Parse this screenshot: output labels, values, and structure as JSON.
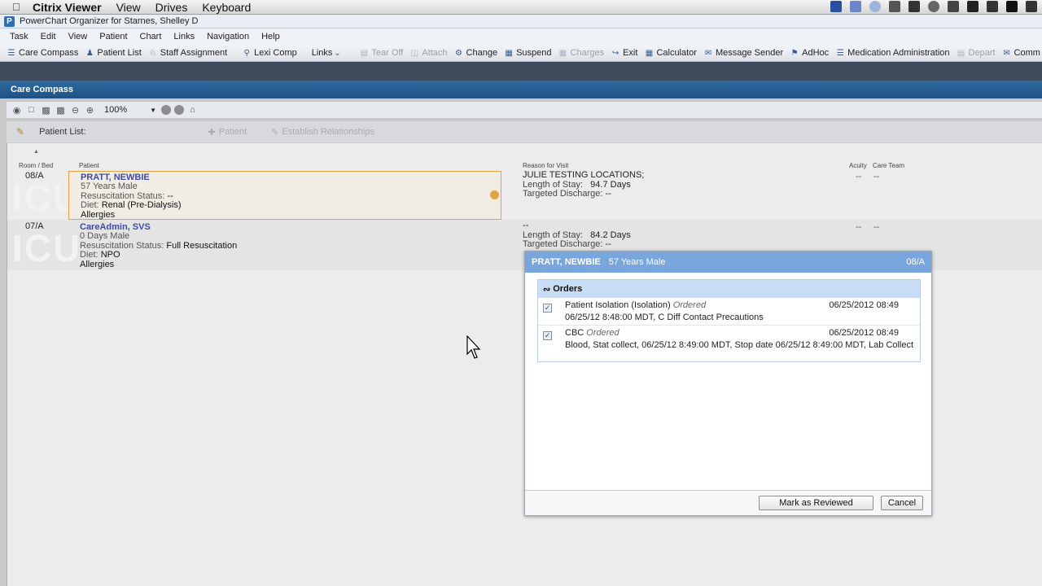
{
  "mac_menu": {
    "items": [
      "Citrix Viewer",
      "View",
      "Drives",
      "Keyboard"
    ]
  },
  "app": {
    "badge": "P",
    "title": "PowerChart Organizer for Starnes, Shelley D"
  },
  "menu": [
    "Task",
    "Edit",
    "View",
    "Patient",
    "Chart",
    "Links",
    "Navigation",
    "Help"
  ],
  "toolbar": {
    "care_compass": "Care Compass",
    "patient_list": "Patient List",
    "staff_assignment": "Staff Assignment",
    "lexi_comp": "Lexi Comp",
    "links": "Links",
    "tear_off": "Tear Off",
    "attach": "Attach",
    "change": "Change",
    "suspend": "Suspend",
    "charges": "Charges",
    "exit": "Exit",
    "calculator": "Calculator",
    "message_sender": "Message Sender",
    "adhoc": "AdHoc",
    "med_admin": "Medication Administration",
    "depart": "Depart",
    "comm": "Comm"
  },
  "care_compass": {
    "title": "Care Compass",
    "zoom": "100%",
    "patient_list_label": "Patient List:",
    "add_patient": "Patient",
    "establish_relationships": "Establish Relationships",
    "columns": {
      "room_bed": "Room / Bed",
      "patient": "Patient",
      "reason": "Reason for Visit",
      "acuity": "Acuity",
      "care_team": "Care Team"
    },
    "watermark": "ICU",
    "patients": [
      {
        "bed": "08/A",
        "name": "PRATT, NEWBIE",
        "age_sex": "57 Years  Male",
        "resus_label": "Resuscitation Status:",
        "resus_value": "--",
        "diet_label": "Diet:",
        "diet_value": "Renal (Pre-Dialysis)",
        "allergies": "Allergies",
        "reason": "JULIE TESTING LOCATIONS;",
        "los_label": "Length of Stay:",
        "los_value": "94.7 Days",
        "discharge_label": "Targeted Discharge:",
        "discharge_value": "--",
        "acuity": "--",
        "care_team": "--"
      },
      {
        "bed": "07/A",
        "name": "CareAdmin, SVS",
        "age_sex": "0 Days  Male",
        "resus_label": "Resuscitation Status:",
        "resus_value": "Full Resuscitation",
        "diet_label": "Diet:",
        "diet_value": "NPO",
        "allergies": "Allergies",
        "reason": "--",
        "los_label": "Length of Stay:",
        "los_value": "84.2 Days",
        "discharge_label": "Targeted Discharge:",
        "discharge_value": "--",
        "acuity": "--",
        "care_team": "--"
      }
    ]
  },
  "popup": {
    "name": "PRATT, NEWBIE",
    "age_sex": "57 Years  Male",
    "bed": "08/A",
    "orders_title": "Orders",
    "orders": [
      {
        "name": "Patient Isolation (Isolation)",
        "status": "Ordered",
        "date": "06/25/2012 08:49",
        "detail": "06/25/12 8:48:00 MDT, C Diff Contact Precautions"
      },
      {
        "name": "CBC",
        "status": "Ordered",
        "date": "06/25/2012 08:49",
        "detail": "Blood, Stat collect, 06/25/12 8:49:00 MDT, Stop date 06/25/12 8:49:00 MDT, Lab Collect"
      }
    ],
    "mark_reviewed": "Mark as Reviewed",
    "cancel": "Cancel"
  }
}
